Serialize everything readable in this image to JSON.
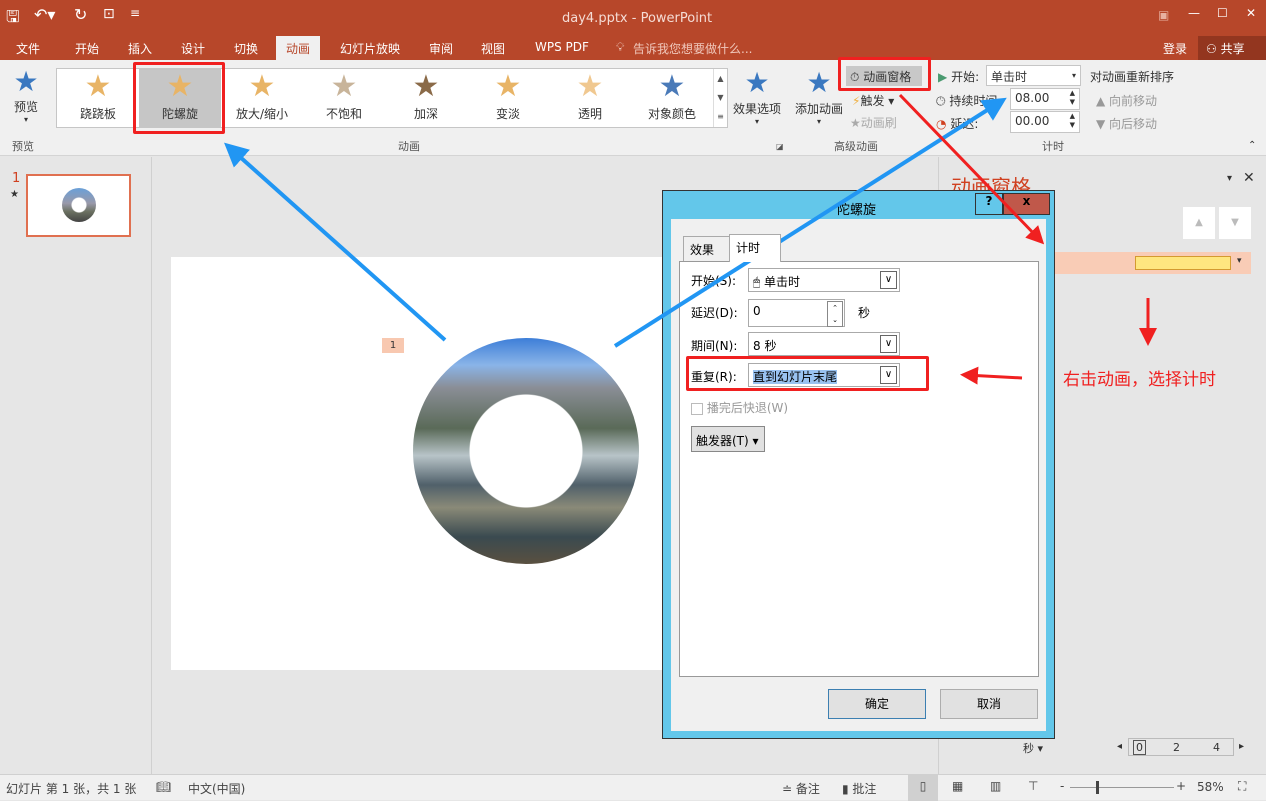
{
  "titlebar": {
    "title": "day4.pptx - PowerPoint",
    "qat_icons": [
      "save-icon",
      "undo-icon",
      "redo-icon",
      "present-icon",
      "customize-icon"
    ]
  },
  "tabs": [
    {
      "label": "文件"
    },
    {
      "label": "开始"
    },
    {
      "label": "插入"
    },
    {
      "label": "设计"
    },
    {
      "label": "切换"
    },
    {
      "label": "动画",
      "active": true
    },
    {
      "label": "幻灯片放映"
    },
    {
      "label": "审阅"
    },
    {
      "label": "视图"
    },
    {
      "label": "WPS PDF"
    }
  ],
  "tellme": "告诉我您想要做什么...",
  "login": "登录",
  "share": "共享",
  "ribbon": {
    "preview": {
      "label": "预览",
      "group": "预览"
    },
    "animations": [
      {
        "label": "跷跷板"
      },
      {
        "label": "陀螺旋",
        "selected": true
      },
      {
        "label": "放大/缩小"
      },
      {
        "label": "不饱和"
      },
      {
        "label": "加深"
      },
      {
        "label": "变淡"
      },
      {
        "label": "透明"
      },
      {
        "label": "对象颜色"
      }
    ],
    "effect_options": "效果选项",
    "animation_group": "动画",
    "add_animation": "添加动画",
    "animation_pane": "动画窗格",
    "trigger": "触发",
    "painter": "动画刷",
    "advanced_group": "高级动画",
    "start_label": "开始:",
    "start_value": "单击时",
    "duration_label": "持续时间:",
    "duration_value": "08.00",
    "delay_label": "延迟:",
    "delay_value": "00.00",
    "timing_group": "计时",
    "reorder": "对动画重新排序",
    "move_earlier": "向前移动",
    "move_later": "向后移动"
  },
  "thumbs": {
    "number": "1",
    "star": "★"
  },
  "slide": {
    "anim_tag": "1"
  },
  "pane": {
    "title": "动画窗格",
    "seconds": "秒",
    "timeline": [
      "0",
      "2",
      "4"
    ]
  },
  "annotation": "右击动画，选择计时",
  "dialog": {
    "title": "陀螺旋",
    "help": "?",
    "close": "x",
    "tabs": [
      "效果",
      "计时"
    ],
    "start_label": "开始(S):",
    "start_value": "单击时",
    "delay_label": "延迟(D):",
    "delay_value": "0",
    "delay_unit": "秒",
    "period_label": "期间(N):",
    "period_value": "8 秒",
    "repeat_label": "重复(R):",
    "repeat_value": "直到幻灯片末尾",
    "rewind_label": "播完后快退(W)",
    "trigger_label": "触发器(T)",
    "ok": "确定",
    "cancel": "取消"
  },
  "status": {
    "slide": "幻灯片 第 1 张，共 1 张",
    "language": "中文(中国)",
    "notes": "备注",
    "comments": "批注",
    "zoom": "58%",
    "zoom_percent": 58
  },
  "colors": {
    "accent": "#b7472a",
    "dialog_frame": "#63c7ea",
    "highlight": "#f02020",
    "arrow_blue": "#2196f3"
  }
}
